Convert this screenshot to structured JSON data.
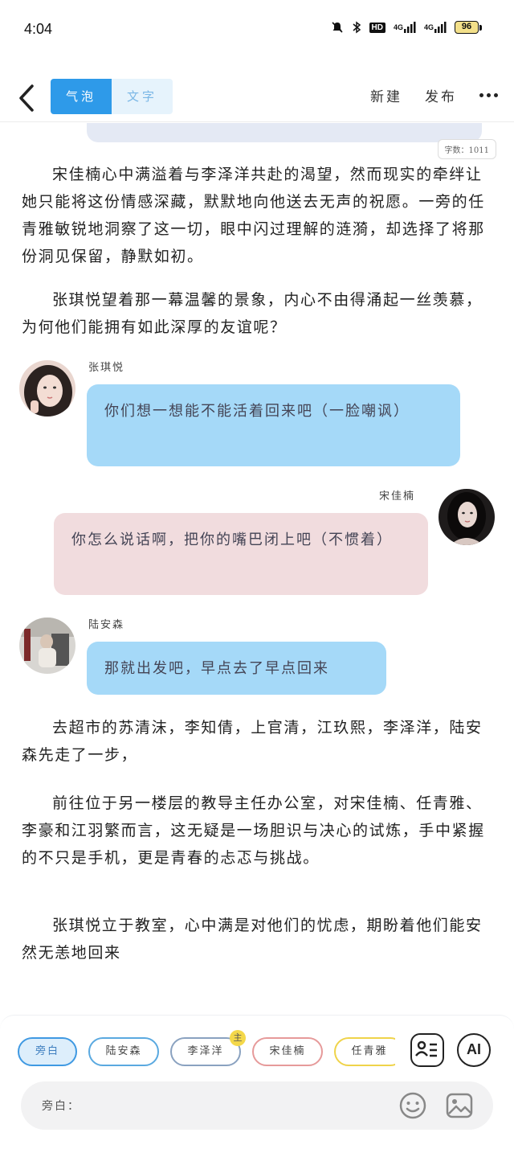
{
  "status_bar": {
    "time": "4:04",
    "hd": "HD",
    "signal1": "4G",
    "signal2": "4G",
    "battery": "96"
  },
  "header": {
    "tabs": [
      "气泡",
      "文字"
    ],
    "new_label": "新建",
    "publish_label": "发布"
  },
  "word_count": "字数：1011",
  "paragraphs": [
    "宋佳楠心中满溢着与李泽洋共赴的渴望，然而现实的牵绊让她只能将这份情感深藏，默默地向他送去无声的祝愿。一旁的任青雅敏锐地洞察了这一切，眼中闪过理解的涟漪，却选择了将那份洞见保留，静默如初。",
    "张琪悦望着那一幕温馨的景象，内心不由得涌起一丝羡慕，为何他们能拥有如此深厚的友谊呢？"
  ],
  "messages": [
    {
      "speaker": "张琪悦",
      "text": "你们想一想能不能活着回来吧（一脸嘲讽）"
    },
    {
      "speaker": "宋佳楠",
      "text": "你怎么说话啊，把你的嘴巴闭上吧（不惯着）"
    },
    {
      "speaker": "陆安森",
      "text": "那就出发吧，早点去了早点回来"
    }
  ],
  "paragraphs_after": [
    "去超市的苏清沫，李知倩，上官清，江玖熙，李泽洋，陆安森先走了一步，",
    "前往位于另一楼层的教导主任办公室，对宋佳楠、任青雅、李豪和江羽繁而言，这无疑是一场胆识与决心的试炼，手中紧握的不只是手机，更是青春的忐忑与挑战。",
    "张琪悦立于教室，心中满是对他们的忧虑，期盼着他们能安然无恙地回来"
  ],
  "bottom": {
    "chips": [
      "旁白",
      "陆安森",
      "李泽洋",
      "宋佳楠",
      "任青雅"
    ],
    "main_badge": "主",
    "ai_label": "AI",
    "input_label": "旁白："
  }
}
